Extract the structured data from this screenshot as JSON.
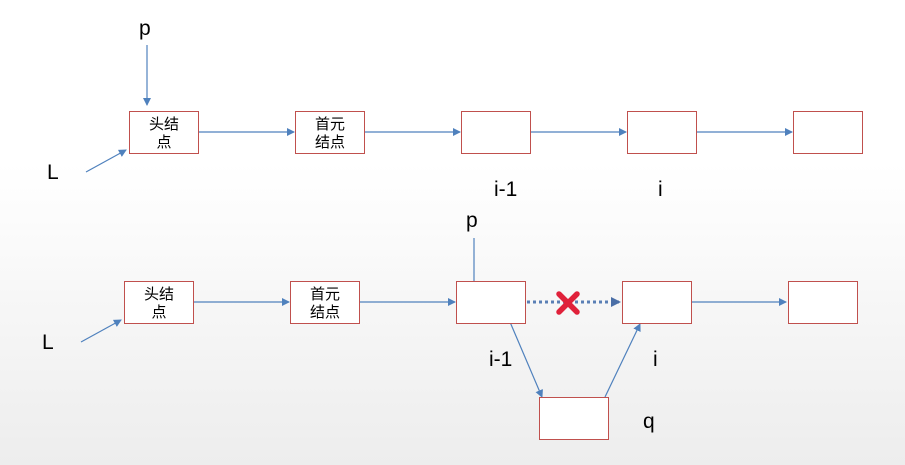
{
  "top_row": {
    "pointer_p": "p",
    "pointer_L": "L",
    "head_node": "头结点",
    "first_node": "首元结点",
    "label_i_minus_1": "i-1",
    "label_i": "i"
  },
  "bottom_row": {
    "pointer_p": "p",
    "pointer_L": "L",
    "pointer_q": "q",
    "head_node": "头结点",
    "first_node": "首元结点",
    "label_i_minus_1": "i-1",
    "label_i": "i"
  },
  "colors": {
    "arrow": "#4f81bd",
    "node_border": "#c0504d",
    "cross": "#e0213a",
    "broken_link": "#5a7fb5"
  }
}
